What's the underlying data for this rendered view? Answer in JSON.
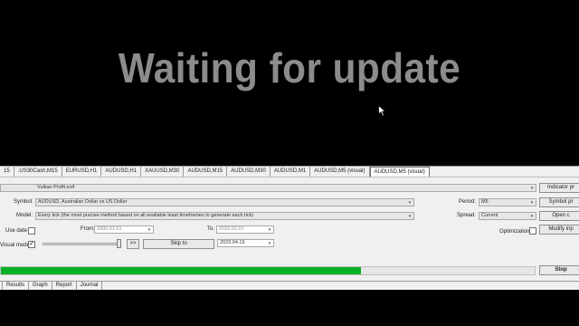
{
  "chart": {
    "waiting_text": "Waiting for update"
  },
  "tabs": [
    {
      "label": "15",
      "active": false
    },
    {
      "label": ".US30Cash,M15",
      "active": false
    },
    {
      "label": "EURUSD,H1",
      "active": false
    },
    {
      "label": "AUDUSD,H1",
      "active": false
    },
    {
      "label": "XAUUSD,M30",
      "active": false
    },
    {
      "label": "AUDUSD,M15",
      "active": false
    },
    {
      "label": "AUDUSD,M30",
      "active": false
    },
    {
      "label": "AUDUSD,M1",
      "active": false
    },
    {
      "label": "AUDUSD,M5 (visual)",
      "active": false
    },
    {
      "label": "AUDUSD,M5 (visual)",
      "active": true
    }
  ],
  "tester": {
    "expert_value": "Vulkan Profit.ex4",
    "indicator_button": "Indicator pr",
    "symbol_label": "Symbol:",
    "symbol_value": "AUDUSD, Australian Dollar vs US Dollar",
    "period_label": "Period:",
    "period_value": "M5",
    "symbol_props_button": "Symbol pr",
    "model_label": "Model:",
    "model_value": "Every tick (the most precise method based on all available least timeframes to generate each tick)",
    "spread_label": "Spread:",
    "spread_value": "Current",
    "open_chart_button": "Open c",
    "use_date_label": "Use date",
    "from_label": "From:",
    "from_value": "2000.01.01",
    "to_label": "To:",
    "to_value": "2022.01.01",
    "optimization_label": "Optimization",
    "modify_button": "Modify inp",
    "visual_mode_label": "Visual mode",
    "visual_mode_checked": true,
    "ffwd_button": ">>",
    "skip_to_button": "Skip to",
    "skip_date_value": "2023.04.19",
    "progress": 0.674,
    "stop_button": "Stop"
  },
  "bottom_tabs": [
    {
      "label": "Results",
      "active": false
    },
    {
      "label": "Graph",
      "active": false
    },
    {
      "label": "Report",
      "active": false
    },
    {
      "label": "Journal",
      "active": false
    }
  ],
  "colors": {
    "progress": "#06b025",
    "background": "#000000",
    "panel": "#f0f0f0"
  }
}
